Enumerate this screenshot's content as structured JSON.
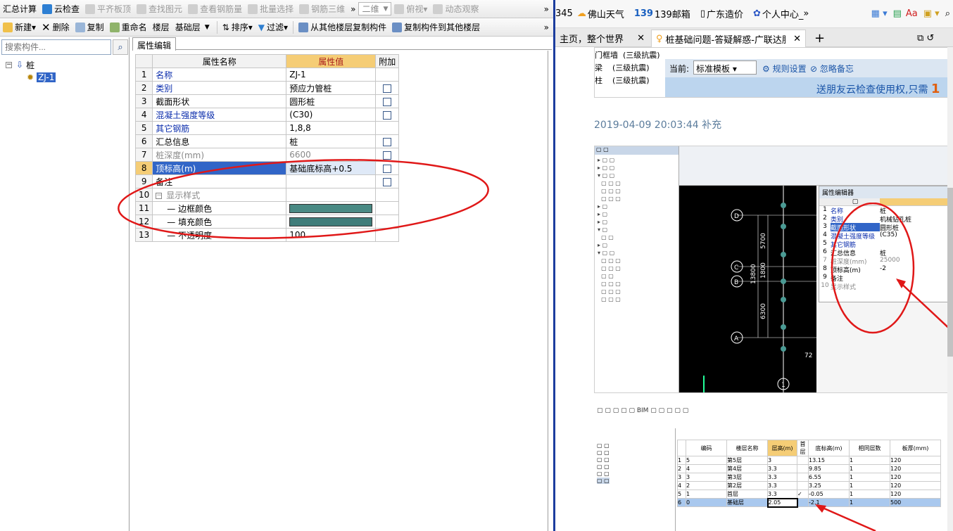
{
  "toolbar1": {
    "items": [
      "汇总计算",
      "云检查",
      "平齐板顶",
      "查找图元",
      "查看钢筋量",
      "批量选择",
      "钢筋三维",
      "二维",
      "俯视",
      "动态观察"
    ]
  },
  "toolbar2": {
    "new": "新建",
    "delete": "删除",
    "copy": "复制",
    "rename": "重命名",
    "floor_label": "楼层",
    "floor_value": "基础层",
    "sort": "排序",
    "filter": "过滤",
    "copy_from": "从其他楼层复制构件",
    "copy_to": "复制构件到其他楼层"
  },
  "sidebar": {
    "search_placeholder": "搜索构件...",
    "tree_root": "桩",
    "tree_child": "ZJ-1"
  },
  "property_panel": {
    "tab": "属性编辑",
    "headers": [
      "属性名称",
      "属性值",
      "附加"
    ],
    "rows": [
      {
        "n": "1",
        "name": "名称",
        "value": "ZJ-1"
      },
      {
        "n": "2",
        "name": "类别",
        "value": "预应力管桩"
      },
      {
        "n": "3",
        "name": "截面形状",
        "value": "圆形桩"
      },
      {
        "n": "4",
        "name": "混凝土强度等级",
        "value": "(C30)"
      },
      {
        "n": "5",
        "name": "其它钢筋",
        "value": "1,8,8"
      },
      {
        "n": "6",
        "name": "汇总信息",
        "value": "桩"
      },
      {
        "n": "7",
        "name": "桩深度(mm)",
        "value": "6600"
      },
      {
        "n": "8",
        "name": "顶标高(m)",
        "value": "基础底标高+0.5"
      },
      {
        "n": "9",
        "name": "备注",
        "value": ""
      },
      {
        "n": "10",
        "name": "显示样式",
        "value": ""
      },
      {
        "n": "11",
        "name": "边框颜色",
        "value": ""
      },
      {
        "n": "12",
        "name": "填充颜色",
        "value": ""
      },
      {
        "n": "13",
        "name": "不透明度",
        "value": "100"
      }
    ],
    "colors": {
      "border_color": "#4a8a84",
      "fill_color": "#3f7d7a"
    }
  },
  "browser": {
    "bookmarks": [
      "佛山天气",
      "139邮箱",
      "广东造价",
      "个人中心_"
    ],
    "bookmark_prefix": "345",
    "tabs": [
      "主页，整个世界",
      "桩基础问题-答疑解惑-广联达服务"
    ],
    "top_rows": [
      {
        "name": "门框墙",
        "grade": "(三级抗震)"
      },
      {
        "name": "梁",
        "grade": "(三级抗震)"
      },
      {
        "name": "柱",
        "grade": "(三级抗震)"
      }
    ],
    "current_label": "当前:",
    "template": "标准模板",
    "rule_setting": "规则设置",
    "ignore_note": "忽略备忘",
    "promo_text": "送朋友云检查使用权,只需",
    "promo_num": "1",
    "timestamp": "2019-04-09 20:03:44 补充",
    "inner_prop_title": "属性编辑器",
    "inner_rows": [
      {
        "n": "1",
        "name": "名称",
        "value": "桩"
      },
      {
        "n": "2",
        "name": "类别",
        "value": "机械钻孔桩"
      },
      {
        "n": "3",
        "name": "截面形状",
        "value": "圆形桩"
      },
      {
        "n": "4",
        "name": "混凝土强度等级",
        "value": "(C35)"
      },
      {
        "n": "5",
        "name": "其它钢筋",
        "value": ""
      },
      {
        "n": "6",
        "name": "汇总信息",
        "value": "桩"
      },
      {
        "n": "7",
        "name": "桩深度(mm)",
        "value": "25000"
      },
      {
        "n": "8",
        "name": "顶标高(m)",
        "value": "-2"
      },
      {
        "n": "9",
        "name": "备注",
        "value": ""
      },
      {
        "n": "10",
        "name": "显示样式",
        "value": ""
      }
    ],
    "floor_table": {
      "headers": [
        "编码",
        "楼层名称",
        "层高(m)",
        "首层",
        "底标高(m)",
        "相同层数",
        "板厚(mm)"
      ],
      "rows": [
        [
          "5",
          "第5层",
          "3",
          "",
          "13.15",
          "1",
          "120"
        ],
        [
          "4",
          "第4层",
          "3.3",
          "",
          "9.85",
          "1",
          "120"
        ],
        [
          "3",
          "第3层",
          "3.3",
          "",
          "6.55",
          "1",
          "120"
        ],
        [
          "2",
          "第2层",
          "3.3",
          "",
          "3.25",
          "1",
          "120"
        ],
        [
          "1",
          "首层",
          "3.3",
          "✓",
          "-0.05",
          "1",
          "120"
        ],
        [
          "0",
          "基础层",
          "2.05",
          "",
          "-2.1",
          "1",
          "500"
        ]
      ]
    }
  }
}
